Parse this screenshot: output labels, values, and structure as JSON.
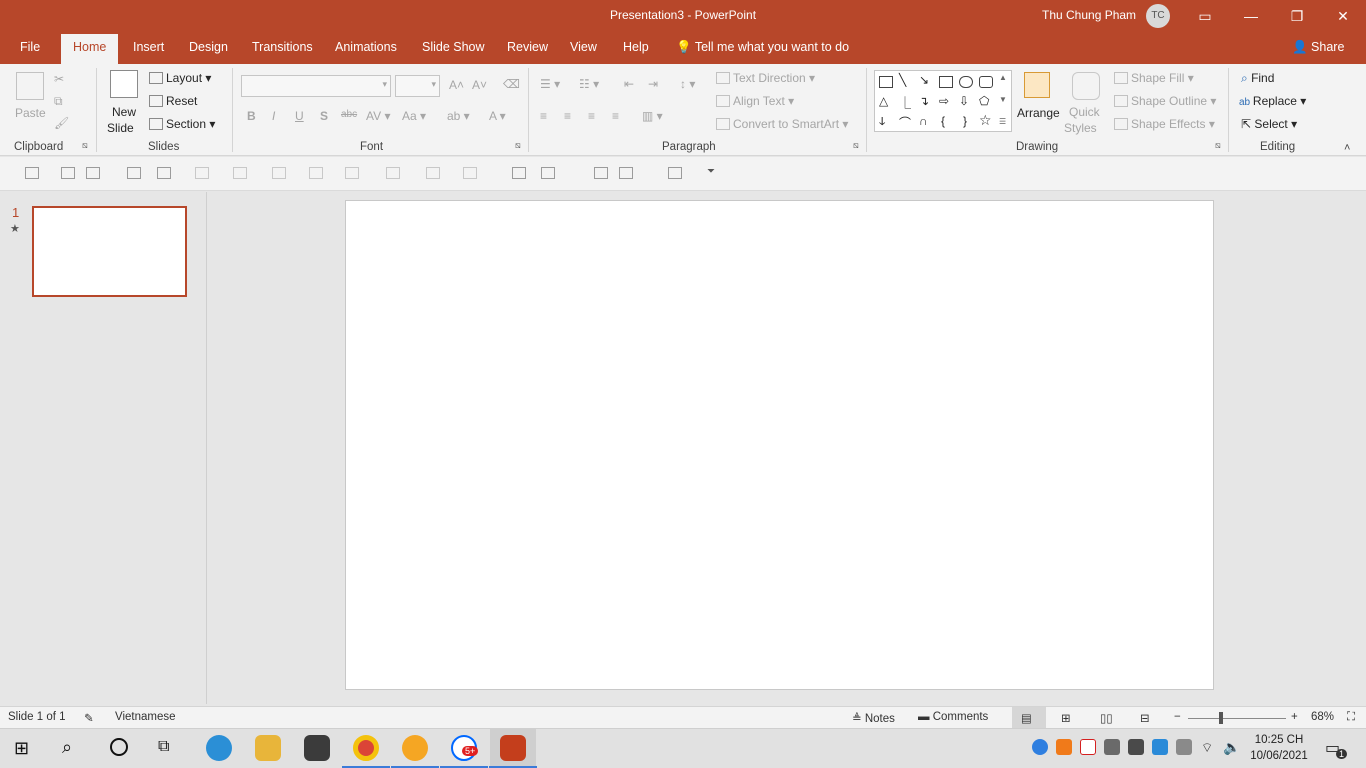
{
  "window": {
    "title": "Presentation3  -  PowerPoint",
    "user": "Thu Chung Pham",
    "user_initials": "TC",
    "accent": "#b7472a"
  },
  "tabs": [
    "File",
    "Home",
    "Insert",
    "Design",
    "Transitions",
    "Animations",
    "Slide Show",
    "Review",
    "View",
    "Help"
  ],
  "active_tab": "Home",
  "tell_me": "Tell me what you want to do",
  "share": "Share",
  "ribbon": {
    "clipboard": {
      "label": "Clipboard",
      "paste": "Paste"
    },
    "slides": {
      "label": "Slides",
      "new_slide_1": "New",
      "new_slide_2": "Slide",
      "layout": "Layout",
      "reset": "Reset",
      "section": "Section"
    },
    "font": {
      "label": "Font",
      "bold": "B",
      "italic": "I",
      "underline": "U",
      "shadow": "S",
      "strike": "abc",
      "case": "Aa",
      "color": "A"
    },
    "paragraph": {
      "label": "Paragraph",
      "text_direction": "Text Direction",
      "align_text": "Align Text",
      "smartart": "Convert to SmartArt"
    },
    "drawing": {
      "label": "Drawing",
      "arrange": "Arrange",
      "quick_1": "Quick",
      "quick_2": "Styles",
      "shape_fill": "Shape Fill",
      "shape_outline": "Shape Outline",
      "shape_effects": "Shape Effects"
    },
    "editing": {
      "label": "Editing",
      "find": "Find",
      "replace": "Replace",
      "select": "Select"
    }
  },
  "slides_panel": {
    "number": "1",
    "star": "★"
  },
  "status": {
    "slide": "Slide 1 of 1",
    "language": "Vietnamese",
    "notes": "Notes",
    "comments": "Comments",
    "zoom": "68%",
    "zoom_fraction": 0.34
  },
  "taskbar": {
    "time": "10:25 CH",
    "date": "10/06/2021",
    "notification_count": "1",
    "zalo_badge": "5+"
  }
}
